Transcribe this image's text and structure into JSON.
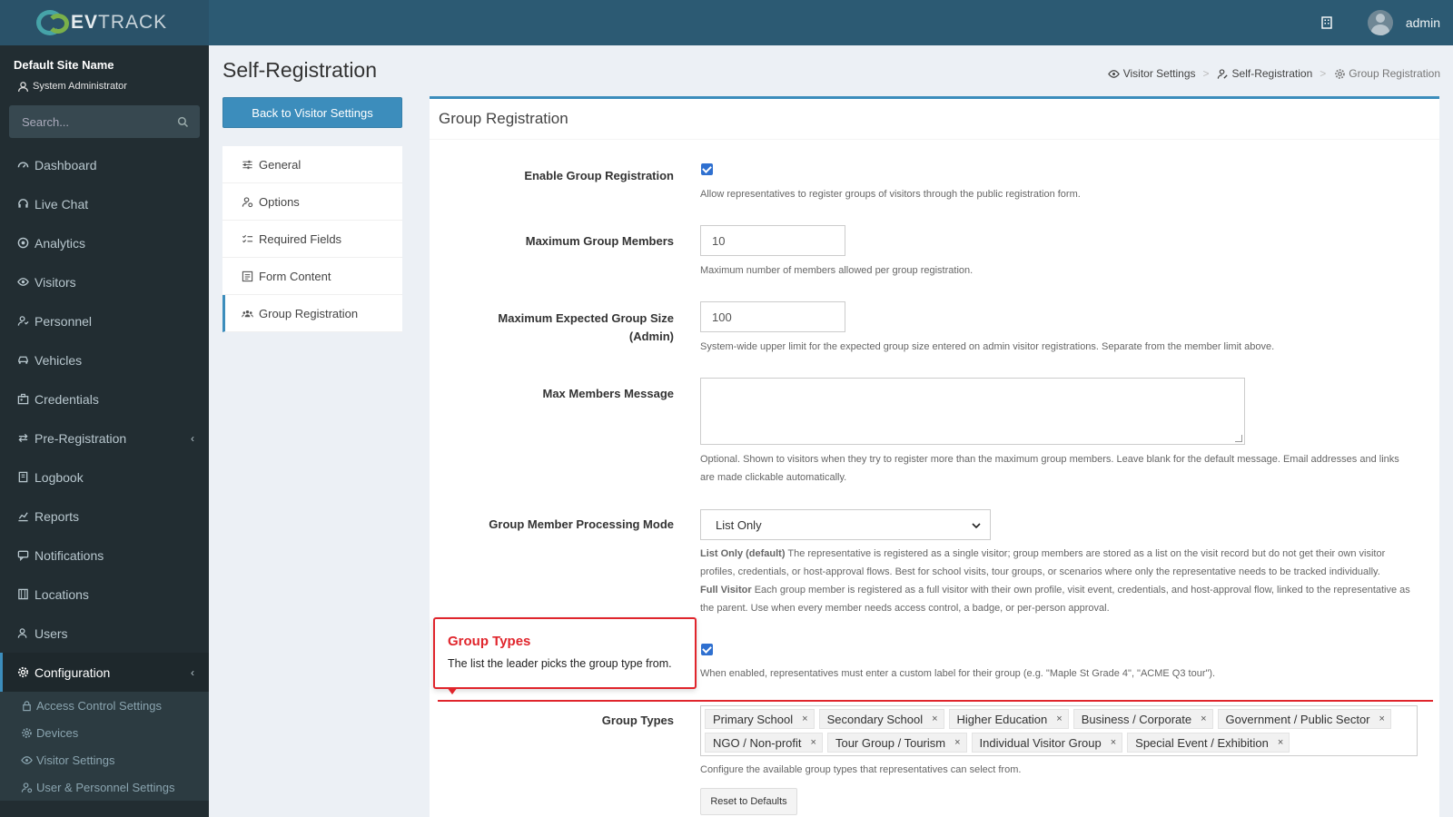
{
  "brand": {
    "logo_text_bold": "EV",
    "logo_text": "TRACK"
  },
  "header": {
    "user": "admin"
  },
  "sidebar": {
    "site_name": "Default Site Name",
    "role": "System Administrator",
    "search_placeholder": "Search...",
    "items": [
      {
        "label": "Dashboard",
        "icon": "dashboard-icon"
      },
      {
        "label": "Live Chat",
        "icon": "headset-icon"
      },
      {
        "label": "Analytics",
        "icon": "analytics-icon"
      },
      {
        "label": "Visitors",
        "icon": "eye-icon"
      },
      {
        "label": "Personnel",
        "icon": "personnel-icon"
      },
      {
        "label": "Vehicles",
        "icon": "car-icon"
      },
      {
        "label": "Credentials",
        "icon": "badge-icon"
      },
      {
        "label": "Pre-Registration",
        "icon": "arrows-icon"
      },
      {
        "label": "Logbook",
        "icon": "book-icon"
      },
      {
        "label": "Reports",
        "icon": "chart-icon"
      },
      {
        "label": "Notifications",
        "icon": "bell-icon"
      },
      {
        "label": "Locations",
        "icon": "building-icon"
      },
      {
        "label": "Users",
        "icon": "user-icon"
      },
      {
        "label": "Configuration",
        "icon": "gear-icon"
      }
    ],
    "sub_items": [
      {
        "label": "Access Control Settings"
      },
      {
        "label": "Devices"
      },
      {
        "label": "Visitor Settings"
      },
      {
        "label": "User & Personnel Settings"
      }
    ]
  },
  "page": {
    "title": "Self-Registration",
    "breadcrumb": [
      "Visitor Settings",
      "Self-Registration",
      "Group Registration"
    ],
    "back_button": "Back to Visitor Settings",
    "subnav": [
      "General",
      "Options",
      "Required Fields",
      "Form Content",
      "Group Registration"
    ]
  },
  "form": {
    "box_title": "Group Registration",
    "enable_group": {
      "label": "Enable Group Registration",
      "checked": true,
      "help": "Allow representatives to register groups of visitors through the public registration form."
    },
    "max_members": {
      "label": "Maximum Group Members",
      "value": "10",
      "help": "Maximum number of members allowed per group registration."
    },
    "max_expected": {
      "label_line1": "Maximum Expected Group Size",
      "label_line2": "(Admin)",
      "value": "100",
      "help": "System-wide upper limit for the expected group size entered on admin visitor registrations. Separate from the member limit above."
    },
    "max_message": {
      "label": "Max Members Message",
      "value": "",
      "help": "Optional. Shown to visitors when they try to register more than the maximum group members. Leave blank for the default message. Email addresses and links are made clickable automatically."
    },
    "processing_mode": {
      "label": "Group Member Processing Mode",
      "selected": "List Only",
      "help_list_title": "List Only (default)",
      "help_list": "The representative is registered as a single visitor; group members are stored as a list on the visit record but do not get their own visitor profiles, credentials, or host-approval flows. Best for school visits, tour groups, or scenarios where only the representative needs to be tracked individually.",
      "help_full_title": "Full Visitor",
      "help_full": "Each group member is registered as a full visitor with their own profile, visit event, credentials, and host-approval flow, linked to the representative as the parent. Use when every member needs access control, a badge, or per-person approval."
    },
    "custom_label": {
      "checked": true,
      "help": "When enabled, representatives must enter a custom label for their group (e.g. \"Maple St Grade 4\", \"ACME Q3 tour\")."
    },
    "group_types": {
      "label": "Group Types",
      "tags": [
        "Primary School",
        "Secondary School",
        "Higher Education",
        "Business / Corporate",
        "Government / Public Sector",
        "NGO / Non-profit",
        "Tour Group / Tourism",
        "Individual Visitor Group",
        "Special Event / Exhibition"
      ],
      "remove_glyph": "×",
      "help": "Configure the available group types that representatives can select from.",
      "reset_button": "Reset to Defaults"
    }
  },
  "tooltip": {
    "title": "Group Types",
    "body": "The list the leader picks the group type from."
  },
  "colors": {
    "accent": "#3c8dbc",
    "sidebar": "#222d32",
    "header": "#2c5a73",
    "highlight": "#e0252c"
  }
}
